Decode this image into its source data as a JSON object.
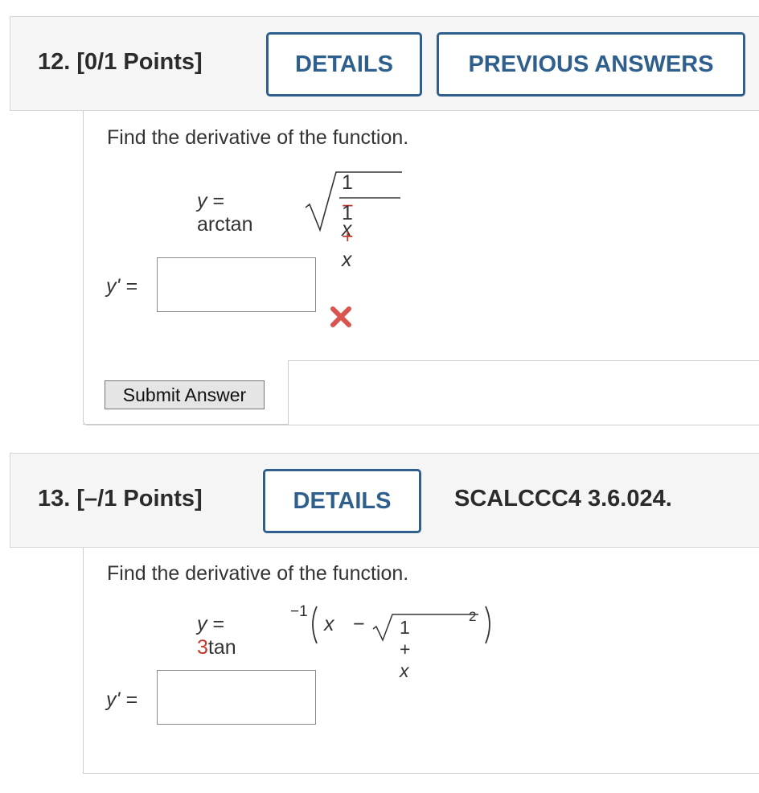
{
  "q12": {
    "number": "12.",
    "points": "[0/1 Points]",
    "details_label": "DETAILS",
    "previous_answers_label": "PREVIOUS ANSWERS",
    "prompt": "Find the derivative of the function.",
    "eq_lhs": "y",
    "eq_sign": "=",
    "eq_func": "arctan",
    "frac_num_1": "1",
    "frac_num_op": "−",
    "frac_num_x": "x",
    "frac_den_1": "1",
    "frac_den_op": "+",
    "frac_den_x": "x",
    "answer_label": "y' =",
    "answer_value": "",
    "incorrect_icon": "x-mark-icon",
    "submit_label": "Submit Answer"
  },
  "q13": {
    "number": "13.",
    "points": "[–/1 Points]",
    "details_label": "DETAILS",
    "reference": "SCALCCC4 3.6.024.",
    "prompt": "Find the derivative of the function.",
    "eq_lhs": "y",
    "eq_sign": "=",
    "coef": "3",
    "func": "tan",
    "exponent": "−1",
    "inner_x": "x",
    "inner_op": "−",
    "root_1": "1",
    "root_op": "+",
    "root_x": "x",
    "root_exp": "2",
    "answer_label": "y' =",
    "answer_value": ""
  },
  "colors": {
    "accent": "#2f5f8d",
    "error": "#d9534f",
    "highlight": "#c0392b"
  }
}
